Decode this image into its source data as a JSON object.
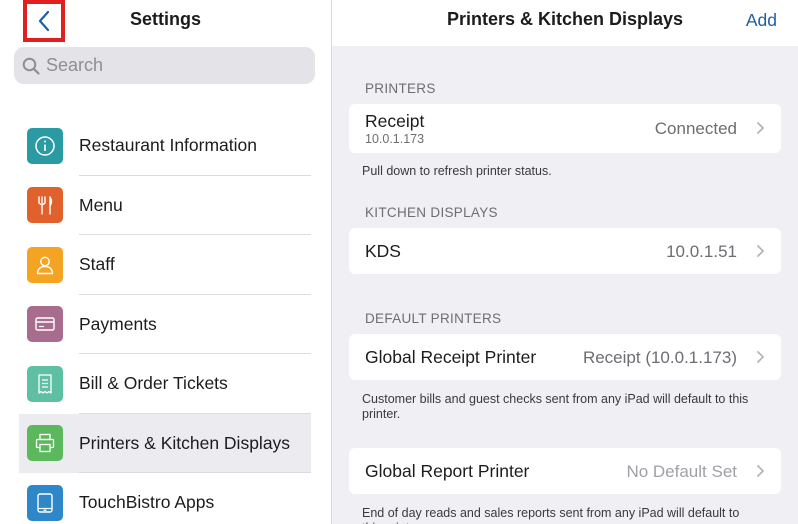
{
  "sidebar": {
    "title": "Settings",
    "search_placeholder": "Search",
    "items": [
      {
        "label": "Restaurant Information",
        "icon": "info-icon",
        "color": "#2a9aa3"
      },
      {
        "label": "Menu",
        "icon": "fork-knife-icon",
        "color": "#e0612c"
      },
      {
        "label": "Staff",
        "icon": "person-icon",
        "color": "#f5a322"
      },
      {
        "label": "Payments",
        "icon": "card-icon",
        "color": "#a86d8e"
      },
      {
        "label": "Bill & Order Tickets",
        "icon": "receipt-icon",
        "color": "#5fbfa3"
      },
      {
        "label": "Printers & Kitchen Displays",
        "icon": "printer-icon",
        "color": "#5cb85c"
      },
      {
        "label": "TouchBistro Apps",
        "icon": "tablet-icon",
        "color": "#2d87c9"
      }
    ]
  },
  "main": {
    "title": "Printers & Kitchen Displays",
    "add_label": "Add",
    "printers": {
      "header": "PRINTERS",
      "receipt_title": "Receipt",
      "receipt_ip": "10.0.1.173",
      "receipt_status": "Connected",
      "note": "Pull down to refresh printer status."
    },
    "kitchen": {
      "header": "KITCHEN DISPLAYS",
      "kds_title": "KDS",
      "kds_ip": "10.0.1.51"
    },
    "defaults": {
      "header": "DEFAULT PRINTERS",
      "receipt_printer_label": "Global Receipt Printer",
      "receipt_printer_value": "Receipt (10.0.1.173)",
      "receipt_note": "Customer bills and guest checks sent from any iPad will default to this printer.",
      "report_printer_label": "Global Report Printer",
      "report_printer_value": "No Default Set",
      "report_note": "End of day reads and sales reports sent from any iPad will default to this printer."
    }
  },
  "colors": {
    "accent": "#1d5fa8",
    "highlight_border": "#e0201f"
  }
}
